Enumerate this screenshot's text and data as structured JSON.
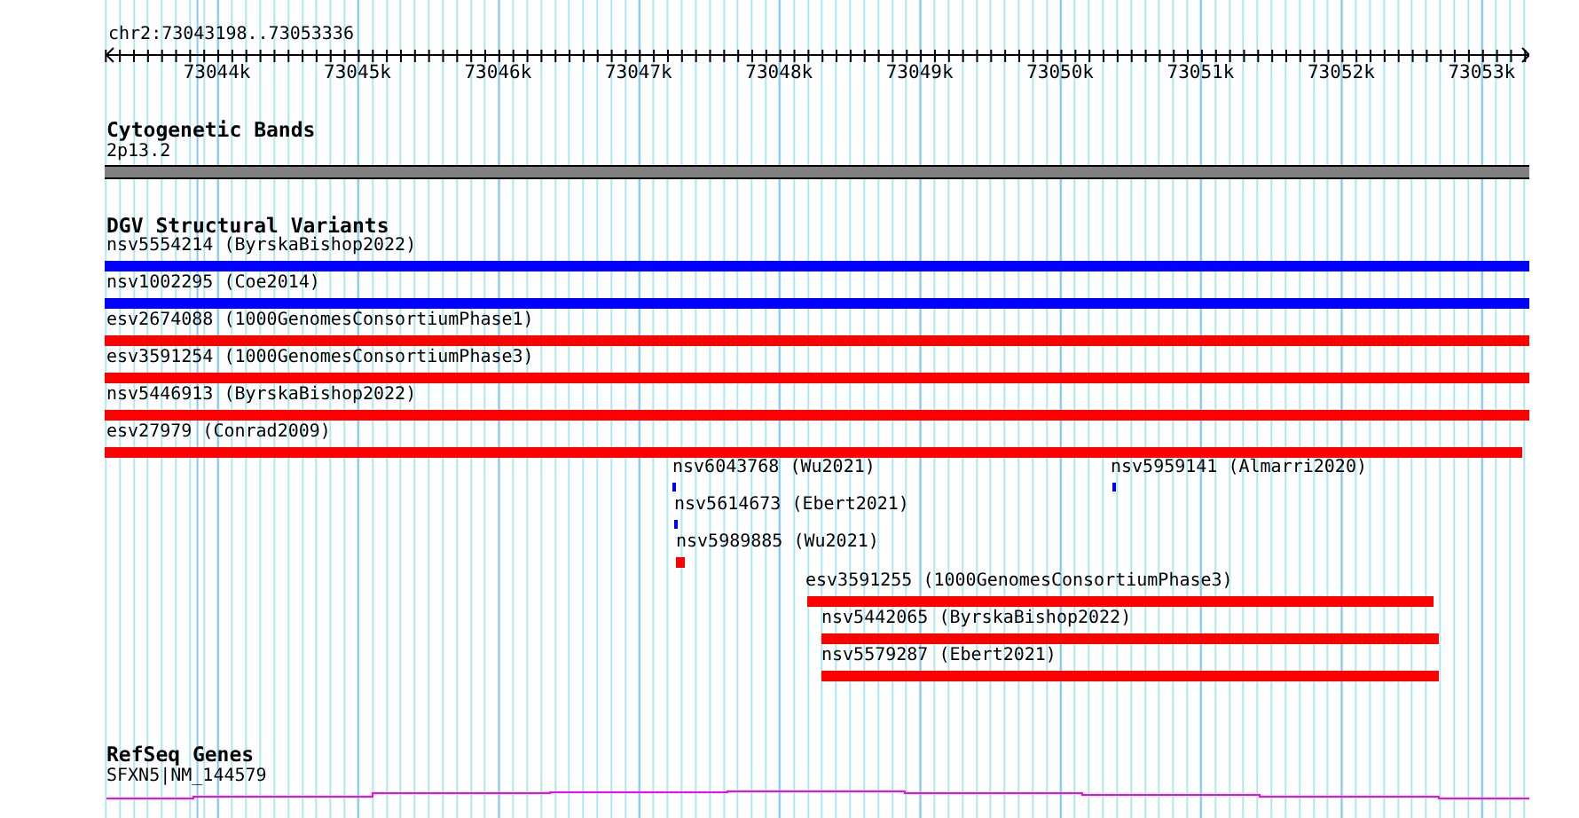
{
  "ruler": {
    "location": "chr2:73043198..73053336",
    "tick_labels": [
      "73044k",
      "73045k",
      "73046k",
      "73047k",
      "73048k",
      "73049k",
      "73050k",
      "73051k",
      "73052k",
      "73053k"
    ]
  },
  "tracks": [
    {
      "kind": "bands",
      "title": "Cytogenetic Bands",
      "features": [
        {
          "label": "2p13.2"
        }
      ]
    },
    {
      "kind": "variants",
      "title": "DGV Structural Variants",
      "features": [
        {
          "label": "nsv5554214 (ByrskaBishop2022)",
          "color": "#0000ff"
        },
        {
          "label": "nsv1002295 (Coe2014)",
          "color": "#0000ff"
        },
        {
          "label": "esv2674088 (1000GenomesConsortiumPhase1)",
          "color": "#ff0000"
        },
        {
          "label": "esv3591254 (1000GenomesConsortiumPhase3)",
          "color": "#ff0000"
        },
        {
          "label": "nsv5446913 (ByrskaBishop2022)",
          "color": "#ff0000"
        },
        {
          "label": "esv27979 (Conrad2009)",
          "color": "#ff0000"
        },
        {
          "label": "nsv6043768 (Wu2021)",
          "color": "#0000ff"
        },
        {
          "label": "nsv5959141 (Almarri2020)",
          "color": "#0000ff"
        },
        {
          "label": "nsv5614673 (Ebert2021)",
          "color": "#0000ff"
        },
        {
          "label": "nsv5989885 (Wu2021)",
          "color": "#ff0000"
        },
        {
          "label": "esv3591255 (1000GenomesConsortiumPhase3)",
          "color": "#ff0000"
        },
        {
          "label": "nsv5442065 (ByrskaBishop2022)",
          "color": "#ff0000"
        },
        {
          "label": "nsv5579287 (Ebert2021)",
          "color": "#ff0000"
        }
      ]
    },
    {
      "kind": "genes",
      "title": "RefSeq Genes",
      "features": [
        {
          "label": "SFXN5|NM_144579"
        }
      ]
    }
  ]
}
